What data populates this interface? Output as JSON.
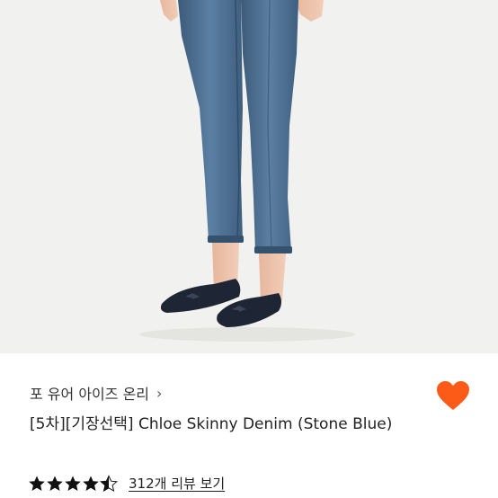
{
  "product": {
    "brand": "포 유어 아이즈 온리",
    "brand_chevron": "›",
    "title": "[5차][기장선택] Chloe Skinny Denim (Stone Blue)",
    "rating_value": 4.5,
    "review_link": "312개 리뷰 보기"
  },
  "icons": {
    "wishlist": "heart-icon",
    "brand_chevron": "chevron-right-icon",
    "rating": "star-icon"
  },
  "colors": {
    "heart": "#fc5a17",
    "star": "#111111",
    "background_hero": "#f1f1ef"
  }
}
